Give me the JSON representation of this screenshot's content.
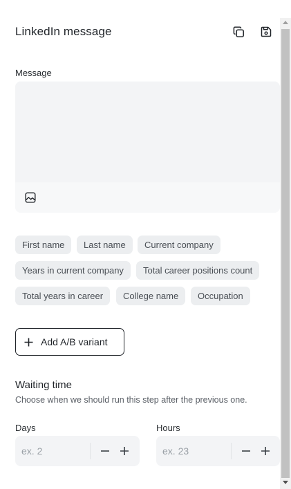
{
  "header": {
    "title": "LinkedIn message",
    "copy_icon": "copy-icon",
    "save_icon": "save-icon"
  },
  "message": {
    "label": "Message",
    "value": "",
    "image_icon": "image-icon"
  },
  "variables": [
    "First name",
    "Last name",
    "Current company",
    "Years in current company",
    "Total career positions count",
    "Total years in career",
    "College name",
    "Occupation"
  ],
  "ab_variant": {
    "label": "Add A/B variant",
    "icon": "plus-icon"
  },
  "waiting": {
    "title": "Waiting time",
    "description": "Choose when we should run this step after the previous one.",
    "days": {
      "label": "Days",
      "placeholder": "ex. 2",
      "value": ""
    },
    "hours": {
      "label": "Hours",
      "placeholder": "ex. 23",
      "value": ""
    }
  },
  "colors": {
    "chip_bg": "#eceef0",
    "field_bg": "#f3f4f6",
    "text": "#1f2328",
    "muted": "#5a5f66"
  }
}
